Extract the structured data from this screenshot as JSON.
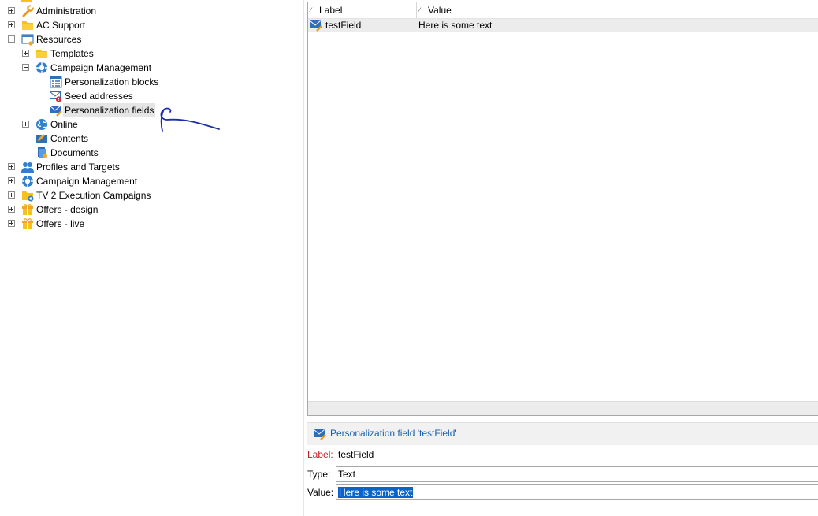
{
  "tree": {
    "items": [
      {
        "label": "Administration",
        "icon": "wrench-icon",
        "expander": "plus"
      },
      {
        "label": "AC Support",
        "icon": "folder-icon",
        "expander": "plus"
      },
      {
        "label": "Resources",
        "icon": "resources-folder-icon",
        "expander": "minus"
      },
      {
        "label": "Templates",
        "icon": "folder-icon",
        "expander": "plus"
      },
      {
        "label": "Campaign Management",
        "icon": "campaign-icon",
        "expander": "minus"
      },
      {
        "label": "Personalization blocks",
        "icon": "list-icon",
        "expander": "none"
      },
      {
        "label": "Seed addresses",
        "icon": "envelope-alert-icon",
        "expander": "none"
      },
      {
        "label": "Personalization fields",
        "icon": "envelope-pencil-icon",
        "expander": "none",
        "selected": true
      },
      {
        "label": "Online",
        "icon": "globe-icon",
        "expander": "plus"
      },
      {
        "label": "Contents",
        "icon": "contents-folder-icon",
        "expander": "none"
      },
      {
        "label": "Documents",
        "icon": "documents-icon",
        "expander": "none"
      },
      {
        "label": "Profiles and Targets",
        "icon": "people-icon",
        "expander": "plus"
      },
      {
        "label": "Campaign Management",
        "icon": "campaign-icon",
        "expander": "plus"
      },
      {
        "label": "TV 2 Execution Campaigns",
        "icon": "folder-add-icon",
        "expander": "plus"
      },
      {
        "label": "Offers - design",
        "icon": "gift-icon",
        "expander": "plus"
      },
      {
        "label": "Offers - live",
        "icon": "gift-icon",
        "expander": "plus"
      }
    ]
  },
  "grid": {
    "columns": [
      "Label",
      "Value"
    ],
    "rows": [
      {
        "label": "testField",
        "value": "Here is some text",
        "icon": "envelope-pencil-icon"
      }
    ]
  },
  "detail": {
    "title": "Personalization field 'testField'",
    "label_caption": "Label:",
    "label_value": "testField",
    "type_caption": "Type:",
    "type_value": "Text",
    "value_caption": "Value:",
    "value_value": "Here is some text"
  },
  "colors": {
    "accent": "#1a5ea8",
    "required": "#c0202a",
    "selection": "#0a64c8",
    "annotation_ink": "#1a2ea8"
  }
}
